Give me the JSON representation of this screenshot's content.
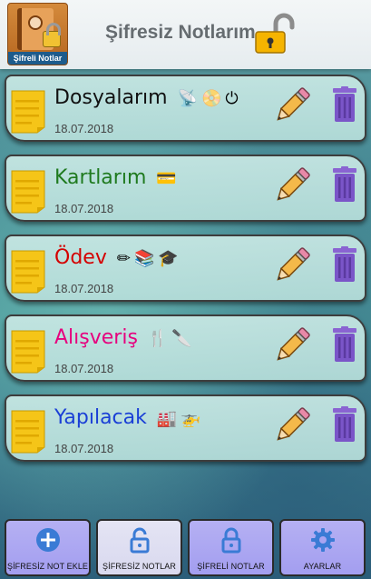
{
  "header": {
    "logo_caption": "Şifreli Notlar",
    "title": "Şifresiz Notlarım",
    "lock_icon": "unlocked-padlock-icon"
  },
  "notes": [
    {
      "title": "Dosyalarım",
      "title_color": "#111111",
      "date": "18.07.2018",
      "emojis": [
        "satellite-dish-emoji",
        "dvd-emoji",
        "power-button-emoji"
      ]
    },
    {
      "title": "Kartlarım",
      "title_color": "#1f7a1f",
      "date": "18.07.2018",
      "emojis": [
        "credit-card-emoji"
      ]
    },
    {
      "title": "Ödev",
      "title_color": "#d40000",
      "date": "18.07.2018",
      "emojis": [
        "pencil-emoji",
        "books-emoji",
        "graduation-cap-emoji"
      ]
    },
    {
      "title": "Alışveriş",
      "title_color": "#e6007e",
      "date": "18.07.2018",
      "emojis": [
        "fork-knife-emoji",
        "kitchen-knife-emoji"
      ]
    },
    {
      "title": "Yapılacak",
      "title_color": "#1a3fd6",
      "date": "18.07.2018",
      "emojis": [
        "factory-emoji",
        "helicopter-emoji"
      ]
    }
  ],
  "actions": {
    "edit_icon": "pencil-edit-icon",
    "delete_icon": "trash-icon"
  },
  "nav": [
    {
      "label": "ŞİFRESİZ NOT EKLE",
      "icon": "add-circle-icon",
      "active": false
    },
    {
      "label": "ŞİFRESİZ NOTLAR",
      "icon": "unlocked-icon",
      "active": true
    },
    {
      "label": "ŞİFRELİ NOTLAR",
      "icon": "locked-icon",
      "active": false
    },
    {
      "label": "AYARLAR",
      "icon": "gear-icon",
      "active": false
    }
  ],
  "colors": {
    "accent": "#3a7bd5",
    "nav_button": "#a9a4f1",
    "trash": "#7a55c8",
    "note_yellow": "#f5c518"
  }
}
